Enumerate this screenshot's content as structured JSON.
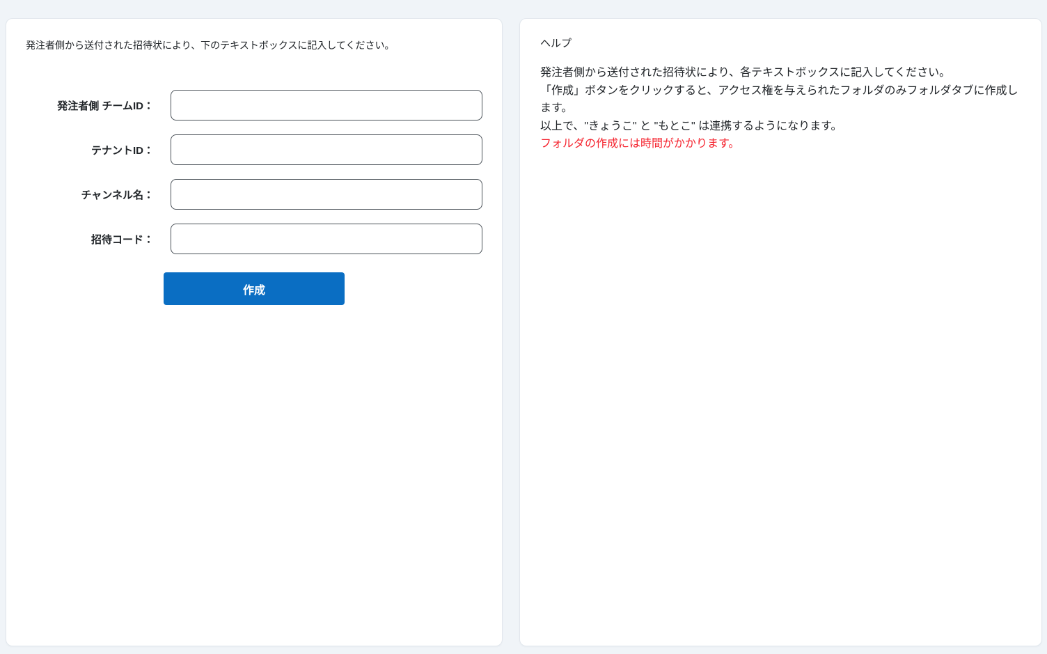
{
  "colors": {
    "page_bg": "#f0f4f8",
    "panel_bg": "#ffffff",
    "panel_border": "#e2e7ed",
    "text": "#212529",
    "input_border": "#495057",
    "accent": "#0a6ec3",
    "accent_text": "#ffffff",
    "warning": "#f5222d"
  },
  "form_panel": {
    "instruction": "発注者側から送付された招待状により、下のテキストボックスに記入してください。",
    "fields": [
      {
        "label": "発注者側 チームID：",
        "value": ""
      },
      {
        "label": "テナントID：",
        "value": ""
      },
      {
        "label": "チャンネル名：",
        "value": ""
      },
      {
        "label": "招待コード：",
        "value": ""
      }
    ],
    "create_button_label": "作成"
  },
  "help_panel": {
    "title": "ヘルプ",
    "lines": [
      {
        "text": "発注者側から送付された招待状により、各テキストボックスに記入してください。",
        "style": "normal"
      },
      {
        "text": "「作成」ボタンをクリックすると、アクセス権を与えられたフォルダのみフォルダタブに作成します。",
        "style": "normal"
      },
      {
        "text": "以上で、\"きょうこ\" と \"もとこ\" は連携するようになります。",
        "style": "normal"
      },
      {
        "text": "フォルダの作成には時間がかかります。",
        "style": "warning"
      }
    ]
  }
}
